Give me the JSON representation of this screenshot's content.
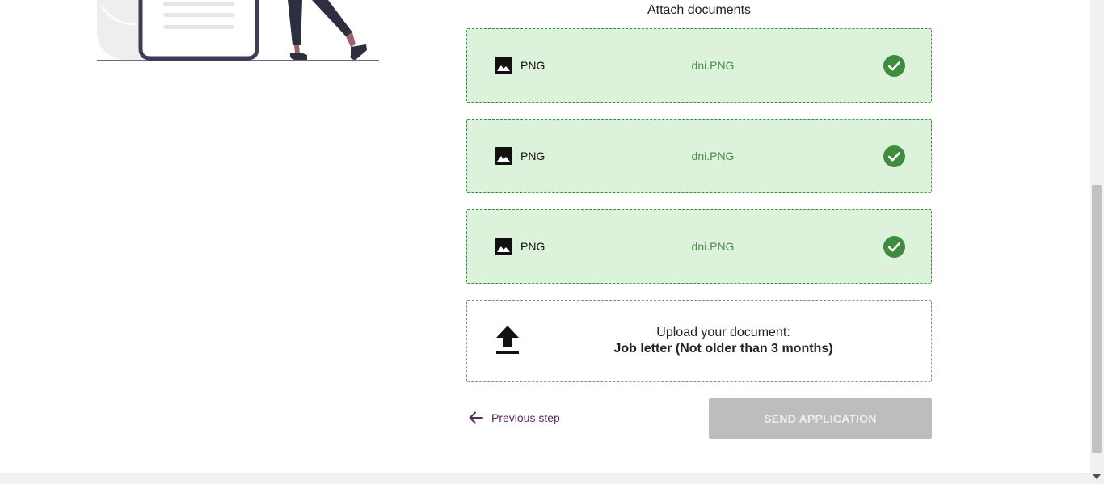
{
  "page": {
    "section_title": "Attach documents"
  },
  "documents": [
    {
      "type_label": "PNG",
      "file_name": "dni.PNG",
      "type_icon": "image-icon",
      "status_icon": "check-circle-icon",
      "status": "uploaded"
    },
    {
      "type_label": "PNG",
      "file_name": "dni.PNG",
      "type_icon": "image-icon",
      "status_icon": "check-circle-icon",
      "status": "uploaded"
    },
    {
      "type_label": "PNG",
      "file_name": "dni.PNG",
      "type_icon": "image-icon",
      "status_icon": "check-circle-icon",
      "status": "uploaded"
    }
  ],
  "upload": {
    "line1": "Upload your document:",
    "line2": "Job letter (Not older than 3 months)",
    "icon": "upload-icon"
  },
  "nav": {
    "previous_label": "Previous step",
    "previous_icon": "arrow-left-icon",
    "send_label": "SEND APPLICATION",
    "send_disabled": true
  },
  "colors": {
    "success_bg": "#dcf2db",
    "success_border": "#3e8c3e",
    "success_icon": "#3e8c3e",
    "filename_text": "#4a8a4a",
    "link": "#5d2a5d",
    "disabled_button": "#bdbdbd"
  }
}
